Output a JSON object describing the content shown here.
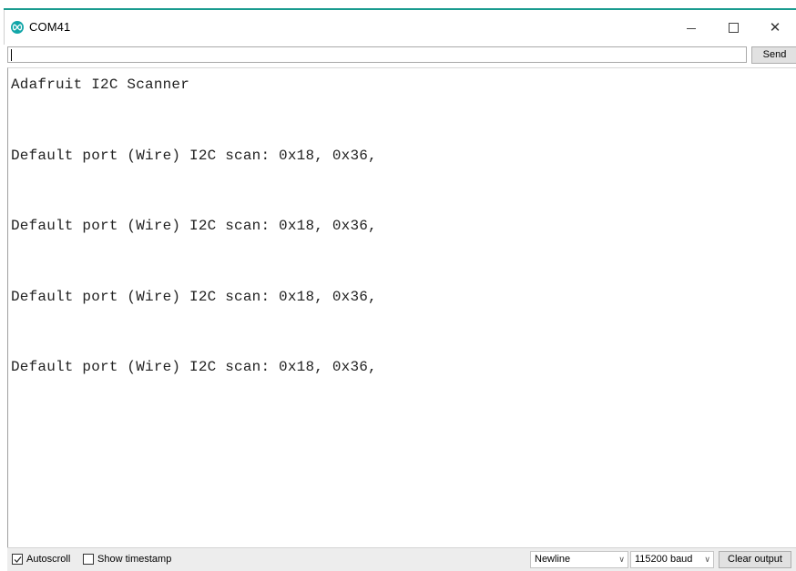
{
  "window": {
    "title": "COM41",
    "minimize_glyph": "–",
    "close_glyph": "✕"
  },
  "send": {
    "input_value": "",
    "button_label": "Send"
  },
  "output": {
    "lines": [
      "Adafruit I2C Scanner",
      "Default port (Wire) I2C scan: 0x18, 0x36,",
      "Default port (Wire) I2C scan: 0x18, 0x36,",
      "Default port (Wire) I2C scan: 0x18, 0x36,",
      "Default port (Wire) I2C scan: 0x18, 0x36,"
    ]
  },
  "statusbar": {
    "autoscroll_label": "Autoscroll",
    "autoscroll_checked": true,
    "timestamp_label": "Show timestamp",
    "timestamp_checked": false,
    "line_ending": "Newline",
    "baud": "115200 baud",
    "clear_label": "Clear output"
  },
  "colors": {
    "accent": "#1a9b8f",
    "icon": "#12a6a8"
  }
}
